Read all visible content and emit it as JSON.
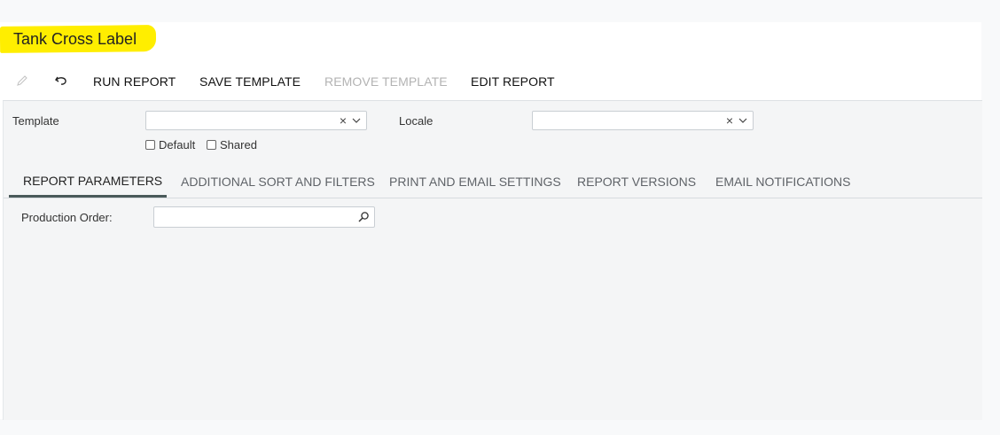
{
  "page": {
    "title": "Tank Cross Label"
  },
  "toolbar": {
    "edit_icon": "pencil-icon",
    "undo_icon": "undo-icon",
    "run_report": "RUN REPORT",
    "save_template": "SAVE TEMPLATE",
    "remove_template": "REMOVE TEMPLATE",
    "edit_report": "EDIT REPORT"
  },
  "form": {
    "template_label": "Template",
    "template_value": "",
    "locale_label": "Locale",
    "locale_value": "",
    "default_label": "Default",
    "default_checked": false,
    "shared_label": "Shared",
    "shared_checked": false,
    "clear_glyph": "×"
  },
  "tabs": [
    {
      "label": "REPORT PARAMETERS",
      "active": true
    },
    {
      "label": "ADDITIONAL SORT AND FILTERS",
      "active": false
    },
    {
      "label": "PRINT AND EMAIL SETTINGS",
      "active": false
    },
    {
      "label": "REPORT VERSIONS",
      "active": false
    },
    {
      "label": "EMAIL NOTIFICATIONS",
      "active": false
    }
  ],
  "parameters": {
    "production_order_label": "Production Order:",
    "production_order_value": ""
  },
  "colors": {
    "highlight": "#ffee00",
    "active_tab_underline": "#4a5a5a",
    "disabled_text": "#b3b3b3"
  }
}
